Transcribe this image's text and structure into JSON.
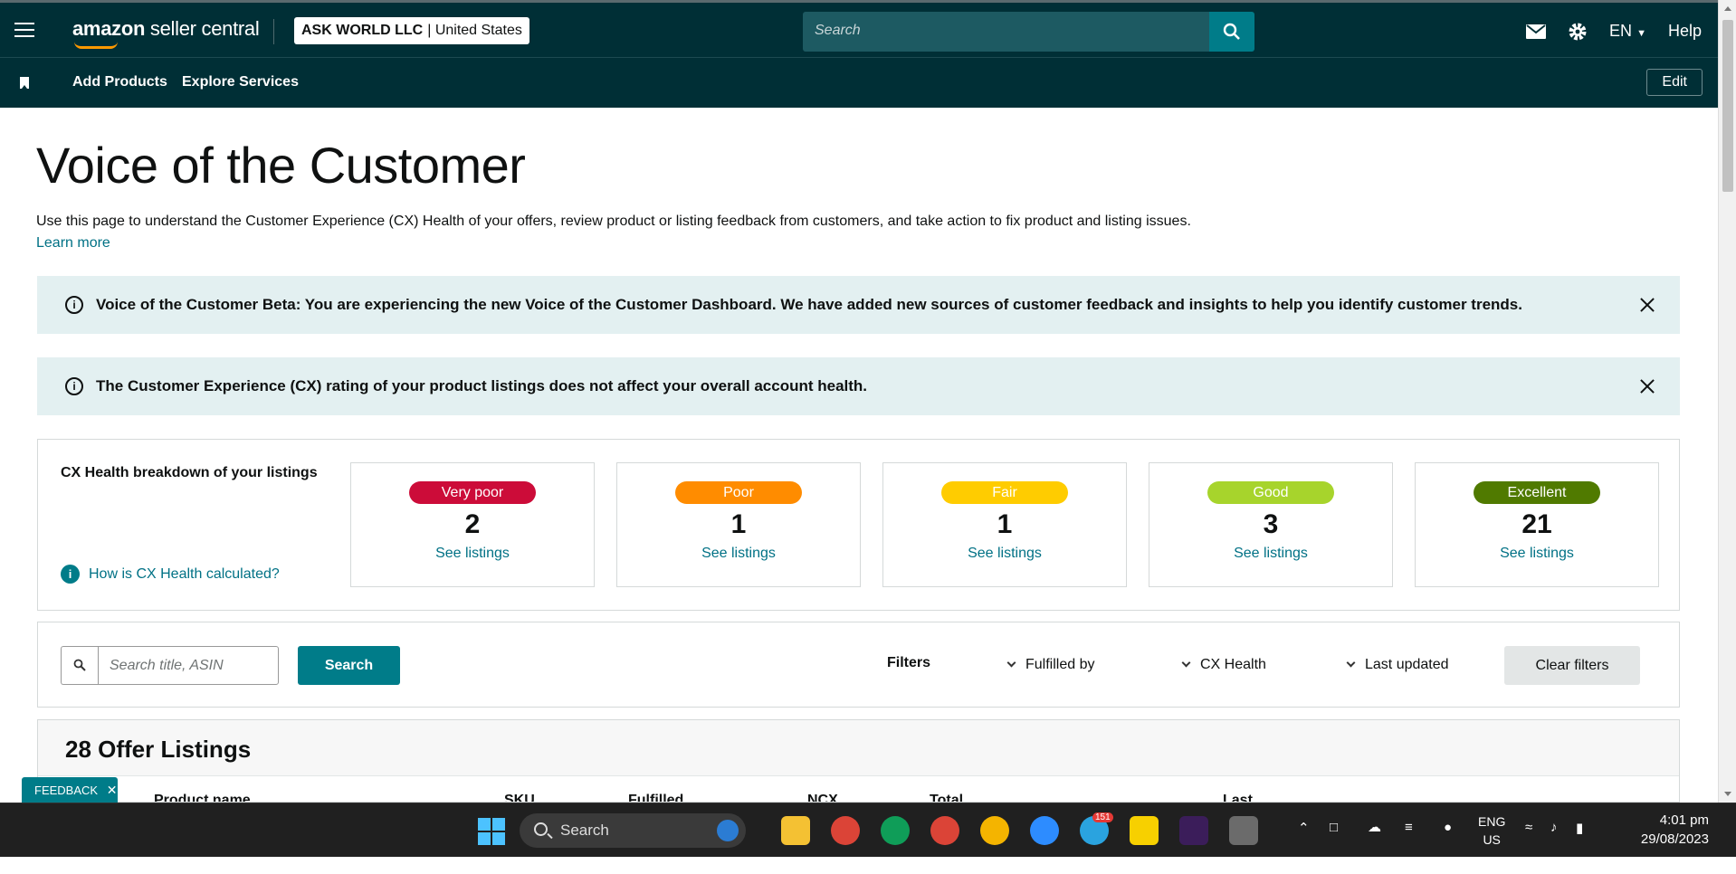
{
  "topbar": {
    "logo_brand": "amazon",
    "logo_product": "seller central",
    "account_name": "ASK WORLD LLC",
    "account_sep": "|",
    "account_region": "United States",
    "search_placeholder": "Search",
    "lang": "EN",
    "help": "Help"
  },
  "navbar": {
    "items": [
      "Add Products",
      "Explore Services"
    ],
    "edit": "Edit"
  },
  "page": {
    "title": "Voice of the Customer",
    "description": "Use this page to understand the Customer Experience (CX) Health of your offers, review product or listing feedback from customers, and take action to fix product and listing issues.",
    "learn_more": "Learn more"
  },
  "alerts": [
    {
      "text": "Voice of the Customer Beta: You are experiencing the new Voice of the Customer Dashboard. We have added new sources of customer feedback and insights to help you identify customer trends."
    },
    {
      "text": "The Customer Experience (CX) rating of your product listings does not affect your overall account health."
    }
  ],
  "cx_health": {
    "label": "CX Health breakdown of your listings",
    "how_link": "How is CX Health calculated?",
    "cards": [
      {
        "badge": "Very poor",
        "count": "2",
        "link": "See listings",
        "color": "#cc0c39",
        "text_color": "#ffffff"
      },
      {
        "badge": "Poor",
        "count": "1",
        "link": "See listings",
        "color": "#ff8c00",
        "text_color": "#ffffff"
      },
      {
        "badge": "Fair",
        "count": "1",
        "link": "See listings",
        "color": "#ffcc00",
        "text_color": "#ffffff"
      },
      {
        "badge": "Good",
        "count": "3",
        "link": "See listings",
        "color": "#a7d42c",
        "text_color": "#ffffff"
      },
      {
        "badge": "Excellent",
        "count": "21",
        "link": "See listings",
        "color": "#507a00",
        "text_color": "#ffffff"
      }
    ]
  },
  "filters": {
    "search_placeholder": "Search title, ASIN",
    "search_button": "Search",
    "label": "Filters",
    "dropdowns": [
      "Fulfilled by",
      "CX Health",
      "Last updated"
    ],
    "clear": "Clear filters"
  },
  "table": {
    "title": "28 Offer Listings",
    "columns": [
      "Product name",
      "SKU",
      "Fulfilled",
      "NCX",
      "Total",
      "Last"
    ]
  },
  "feedback": "FEEDBACK",
  "taskbar": {
    "search": "Search",
    "lang_line1": "ENG",
    "lang_line2": "US",
    "time": "4:01 pm",
    "date": "29/08/2023",
    "badge_telegram": "151"
  },
  "colors": {
    "header_bg": "#002f36",
    "accent": "#007c89",
    "link": "#007185",
    "alert_bg": "#e3f0f1"
  }
}
